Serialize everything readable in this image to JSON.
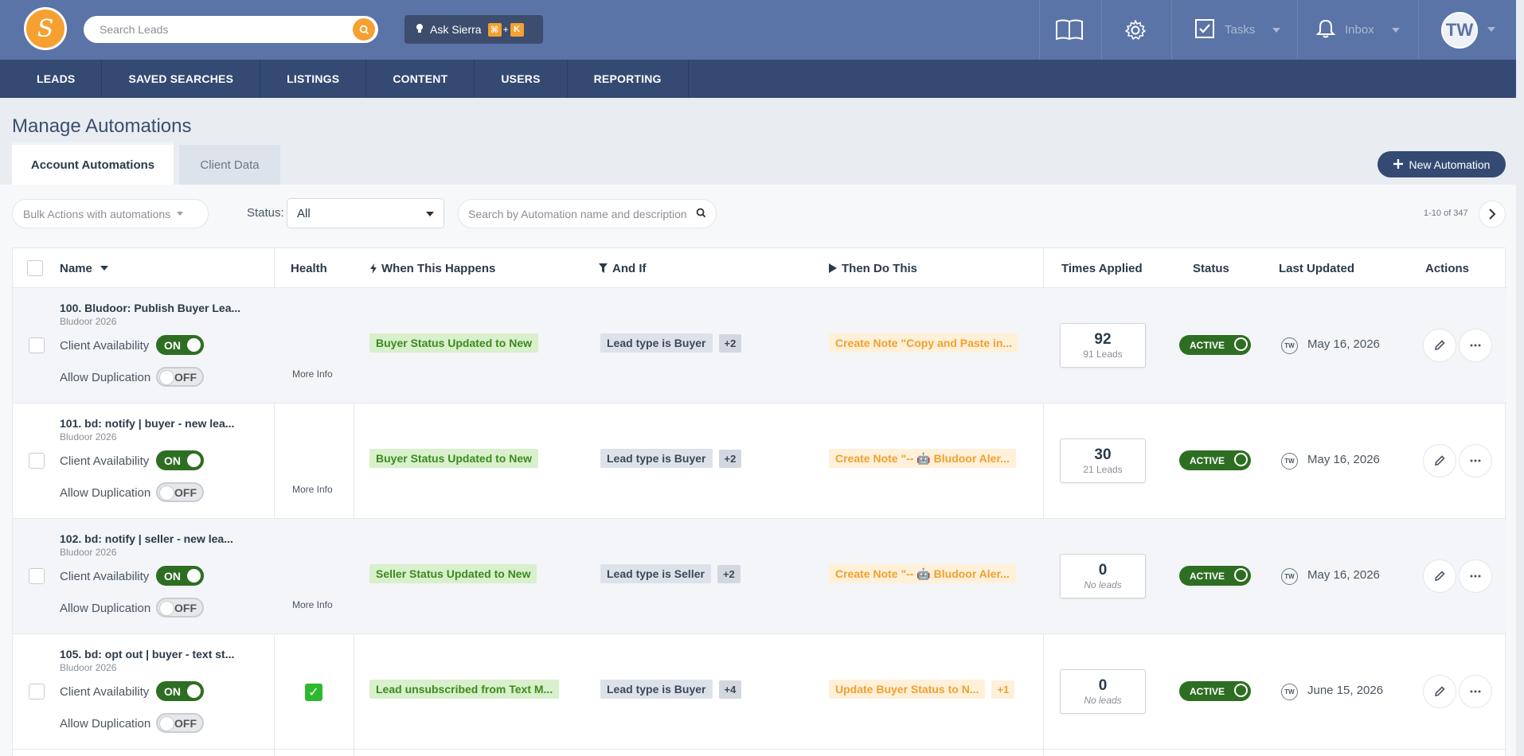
{
  "topbar": {
    "logo": "S",
    "search_placeholder": "Search Leads",
    "ask_sierra": "Ask Sierra",
    "kbd_key1": "⌘",
    "kbd_plus": "+",
    "kbd_key2": "K",
    "tasks": "Tasks",
    "inbox": "Inbox",
    "avatar": "TW"
  },
  "nav": [
    "LEADS",
    "SAVED SEARCHES",
    "LISTINGS",
    "CONTENT",
    "USERS",
    "REPORTING"
  ],
  "page_title": "Manage Automations",
  "tabs": {
    "active": "Account Automations",
    "inactive": "Client Data"
  },
  "new_automation": "New Automation",
  "toolbar": {
    "bulk": "Bulk Actions with automations",
    "status_label": "Status:",
    "status_value": "All",
    "search_placeholder": "Search by Automation name and description",
    "paging": "1-10 of 347"
  },
  "table": {
    "headers": {
      "name": "Name",
      "health": "Health",
      "when": "When This Happens",
      "andif": "And If",
      "then": "Then Do This",
      "times": "Times Applied",
      "status": "Status",
      "updated": "Last Updated",
      "actions": "Actions"
    },
    "labels": {
      "client_availability": "Client Availability",
      "allow_duplication": "Allow Duplication",
      "on": "ON",
      "off": "OFF",
      "more_info": "More Info",
      "active": "ACTIVE",
      "tw": "TW"
    },
    "rows": [
      {
        "title": "100. Bludoor: Publish Buyer Lea...",
        "sub": "Bludoor 2026",
        "health": "red",
        "when": "Buyer Status Updated to New",
        "andif": "Lead type is Buyer",
        "andif_count": "+2",
        "then": "Create Note \"Copy and Paste in...",
        "then_count": "",
        "times": "92",
        "leads": "91 Leads",
        "date": "May 16, 2026"
      },
      {
        "title": "101. bd: notify | buyer - new lea...",
        "sub": "Bludoor 2026",
        "health": "red",
        "when": "Buyer Status Updated to New",
        "andif": "Lead type is Buyer",
        "andif_count": "+2",
        "then": "Create Note \"-- 🤖 Bludoor Aler...",
        "then_count": "",
        "times": "30",
        "leads": "21 Leads",
        "date": "May 16, 2026"
      },
      {
        "title": "102. bd: notify | seller - new lea...",
        "sub": "Bludoor 2026",
        "health": "red",
        "when": "Seller Status Updated to New",
        "andif": "Lead type is Seller",
        "andif_count": "+2",
        "then": "Create Note \"-- 🤖 Bludoor Aler...",
        "then_count": "",
        "times": "0",
        "leads": "No leads",
        "date": "May 16, 2026"
      },
      {
        "title": "105. bd: opt out | buyer - text st...",
        "sub": "Bludoor 2026",
        "health": "ok",
        "when": "Lead unsubscribed from Text M...",
        "andif": "Lead type is Buyer",
        "andif_count": "+4",
        "then": "Update Buyer Status to N...",
        "then_count": "+1",
        "times": "0",
        "leads": "No leads",
        "date": "June 15, 2026"
      }
    ]
  }
}
